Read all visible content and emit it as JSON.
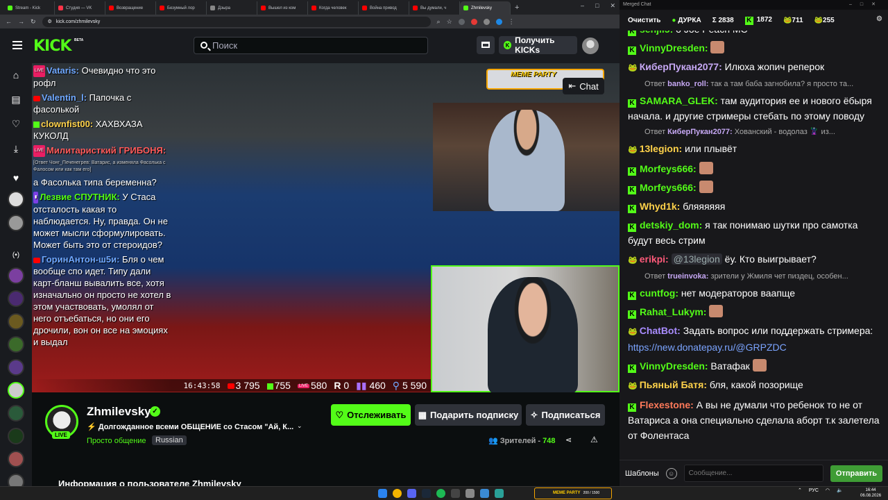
{
  "browser": {
    "tabs": [
      {
        "label": "Stream - Kick",
        "color": "#53fc18"
      },
      {
        "label": "Студия — VK",
        "color": "#ff3347"
      },
      {
        "label": "Возвращение",
        "color": "#ff0000"
      },
      {
        "label": "Безумный лор",
        "color": "#ff0000"
      },
      {
        "label": "Дзыра",
        "color": "#888888"
      },
      {
        "label": "Вышел из ком",
        "color": "#ff0000"
      },
      {
        "label": "Когда человек",
        "color": "#ff0000"
      },
      {
        "label": "Война привод",
        "color": "#ff0000"
      },
      {
        "label": "Вы думали, ч",
        "color": "#ff0000"
      },
      {
        "label": "Zhmilevsky",
        "color": "#53fc18"
      }
    ],
    "url": "kick.com/zhmilevsky"
  },
  "kick": {
    "logo": "KICK",
    "beta": "BETA",
    "search_placeholder": "Поиск",
    "get_kicks": "Получить KICKs"
  },
  "overlay": {
    "meme_party": "MEME PARTY",
    "chat_button": "Chat",
    "messages": [
      {
        "name": "Vataris:",
        "color": "#6fa8ff",
        "text": " Очевидно что это рофл",
        "src": "live"
      },
      {
        "name": "Valentin_l:",
        "color": "#6fa8ff",
        "text": " Папочка с фасолькой",
        "src": "yt"
      },
      {
        "name": "clownfist00:",
        "color": "#ffd24a",
        "text": " ХАХВХАЗА КУКОЛД",
        "src": "kick"
      },
      {
        "name": "Милитаристкий ГРИБОНЯ:",
        "color": "#ff5a5a",
        "text": "",
        "src": "live"
      }
    ],
    "reply_line": "[Ответ Чонг_Печенегрев: Ватарис, а изменяла Фасолька с Фалосом или как там его]",
    "messages2": [
      {
        "name": "",
        "color": "#fff",
        "text": "а Фасолька типа беременна?",
        "src": "none"
      },
      {
        "name": "Лезвие СПУТНИК:",
        "color": "#53fc18",
        "text": " У Стаса отсталость какая то наблюдается. Ну, правда. Он не может мысли сформулировать. Может быть это от стероидов?",
        "src": "twitch"
      },
      {
        "name": "ГоринАнтон-ш5и:",
        "color": "#6fa8ff",
        "text": " Бля о чем вообще спо идет. Типу дали карт-бланш выв­алить все, хотя изначально он просто не хотел в этом участвовать, умолял от него отъебаться, но они его дрочили, вон он все на эмоциях и выдал",
        "src": "yt"
      }
    ],
    "stats": {
      "time": "16:43:58",
      "yt": "3 795",
      "kick": "755",
      "live": "580",
      "r": "0",
      "tw": "460",
      "total": "5 590"
    }
  },
  "stream": {
    "name": "Zhmilevsky",
    "live": "LIVE",
    "title": "Долгожданное всеми ОБЩЕНИЕ со Стасом \"Ай, К...",
    "category": "Просто общение",
    "language": "Russian",
    "follow": "Отслеживать",
    "gift": "Подарить подписку",
    "subscribe": "Подписаться",
    "viewers_label": "Зрителей -",
    "viewers": "748",
    "about": "Информация о пользователе Zhmilevsky"
  },
  "merged_chat": {
    "window_title": "Merged Chat",
    "clear": "Очистить",
    "channel": "ДУРКА",
    "totals": {
      "sum": "Σ 2838",
      "kick": "1872",
      "twitch": "711",
      "vk": "255"
    },
    "templates": "Шаблоны",
    "input_placeholder": "Сообщение...",
    "send": "Отправить",
    "messages": [
      {
        "type": "msg",
        "badge": "kick",
        "name": "senjii5:",
        "color": "#53fc18",
        "text": " о Joe Peach MC"
      },
      {
        "type": "msg",
        "badge": "kick",
        "name": "VinnyDresden:",
        "color": "#53fc18",
        "text": " ",
        "emote": true
      },
      {
        "type": "msg",
        "badge": "frog",
        "name": "КиберПукан2077:",
        "color": "#c6a8f4",
        "text": " Илюха жопич реперок"
      },
      {
        "type": "reply",
        "user": "banko_roll:",
        "text": " так а там баба загнобила? я просто та..."
      },
      {
        "type": "msg",
        "badge": "kick",
        "name": "SAMARA_GLEK:",
        "color": "#53fc18",
        "text": " там аудитория ее и нового ёбыря начала. и другие стримеры стебать по этому поводу"
      },
      {
        "type": "reply",
        "user": "КиберПукан2077:",
        "text": " Хованский - водолаз 🦹 из..."
      },
      {
        "type": "msg",
        "badge": "frog",
        "name": "13legion:",
        "color": "#ffd24a",
        "text": " или  плывёт"
      },
      {
        "type": "msg",
        "badge": "kick",
        "name": "Morfeys666:",
        "color": "#53fc18",
        "text": " ",
        "emote": true
      },
      {
        "type": "msg",
        "badge": "kick",
        "name": "Morfeys666:",
        "color": "#53fc18",
        "text": " ",
        "emote": true
      },
      {
        "type": "msg",
        "badge": "kick",
        "name": "Whyd1k:",
        "color": "#ffd24a",
        "text": " бляяяяяя"
      },
      {
        "type": "msg",
        "badge": "kick",
        "name": "detskiy_dom:",
        "color": "#53fc18",
        "text": " я так понимаю шутки про самотка будут весь стрим"
      },
      {
        "type": "msg",
        "badge": "frog",
        "name": "erikpi:",
        "color": "#ff5a7a",
        "mention": "@13legion",
        "text": " ёу. Кто выигрывает?"
      },
      {
        "type": "reply",
        "user": "trueinvoka:",
        "text": " зрители у Жмиля чет пиздец, особен..."
      },
      {
        "type": "msg",
        "badge": "kick",
        "name": "cuntfog:",
        "color": "#53fc18",
        "text": " нет модераторов ваапще"
      },
      {
        "type": "msg",
        "badge": "kick",
        "name": "Rahat_Lukym:",
        "color": "#53fc18",
        "text": " ",
        "emote": true
      },
      {
        "type": "msg",
        "badge": "frog",
        "name": "ChatBot:",
        "color": "#a98cff",
        "text": " Задать вопрос или поддержать стримера: ",
        "link": "https://new.donatepay.ru/@GRPZDC"
      },
      {
        "type": "msg",
        "badge": "kick",
        "name": "VinnyDresden:",
        "color": "#53fc18",
        "text": " Ватафак",
        "emote": true
      },
      {
        "type": "msg",
        "badge": "frog",
        "name": "Пьяный Батя:",
        "color": "#ffd24a",
        "text": " бля, какой позорище"
      },
      {
        "type": "msg",
        "badge": "kick",
        "name": "Flexestone:",
        "color": "#ff7a5a",
        "text": " А вы не думали что ребенок то не от Ватариса а она специально сделала аборт т.к залетела от Фолентаса"
      }
    ]
  },
  "taskbar": {
    "meme_party": "MEME PARTY",
    "meme_count": "200 / 1500",
    "lang": "РУС",
    "time": "16:44",
    "date": "06.08.2026"
  }
}
